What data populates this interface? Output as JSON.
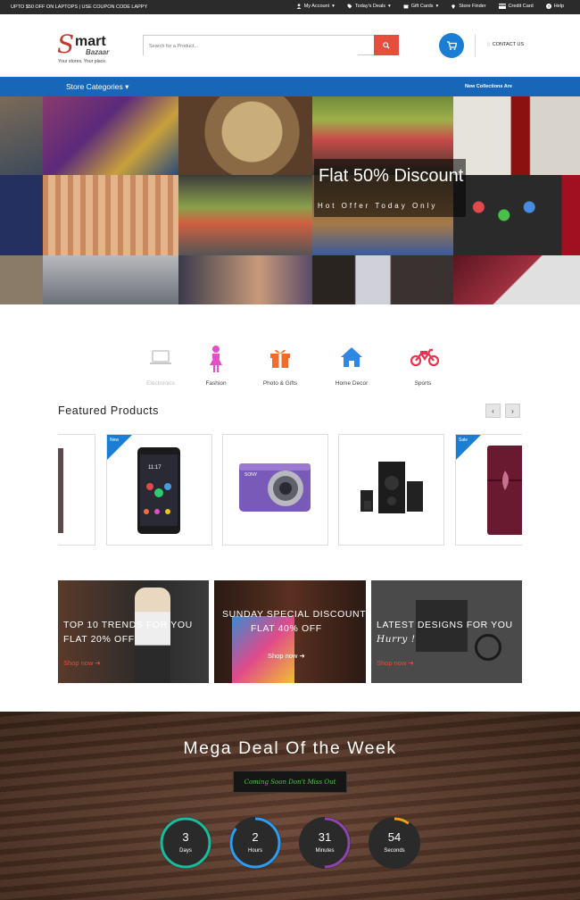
{
  "topbar": {
    "promo": "UPTO $50 OFF ON LAPTOPS | USE COUPON CODE LAPPY",
    "links": [
      {
        "label": "My Account",
        "icon": "user-icon"
      },
      {
        "label": "Today's Deals",
        "icon": "tag-icon"
      },
      {
        "label": "Gift Cards",
        "icon": "gift-icon"
      },
      {
        "label": "Store Finder",
        "icon": "map-pin-icon"
      },
      {
        "label": "Credit Card",
        "icon": "credit-card-icon"
      },
      {
        "label": "Help",
        "icon": "help-icon"
      }
    ]
  },
  "header": {
    "logo_letter": "S",
    "logo_word": "mart",
    "logo_sub": "Bazaar",
    "tagline": "Your stores. Your place.",
    "search_placeholder": "Search for a Product...",
    "contact": "CONTACT US"
  },
  "catbar": {
    "label": "Store Categories",
    "marquee": "New Collections Are"
  },
  "hero": {
    "title": "Flat 50% Discount",
    "subtitle": "Hot Offer Today Only"
  },
  "categories": [
    {
      "label": "Electronics",
      "icon": "laptop-icon",
      "color": "#c8c8c8"
    },
    {
      "label": "Fashion",
      "icon": "woman-icon",
      "color": "#e64ec7"
    },
    {
      "label": "Photo & Gifts",
      "icon": "gift-icon",
      "color": "#f26b2a"
    },
    {
      "label": "Home Decor",
      "icon": "house-icon",
      "color": "#2e86e6"
    },
    {
      "label": "Sports",
      "icon": "motorbike-icon",
      "color": "#e8344e"
    }
  ],
  "featured": {
    "title": "Featured Products",
    "prev": "‹",
    "next": "›",
    "badges": {
      "new": "New",
      "sale": "Sale"
    }
  },
  "banners": [
    {
      "line1": "TOP 10 TRENDS FOR YOU",
      "line2": "FLAT 20% OFF",
      "shop": "Shop now"
    },
    {
      "line1": "SUNDAY SPECIAL DISCOUNT",
      "line2": "FLAT 40% OFF",
      "shop": "Shop now"
    },
    {
      "line1": "LATEST DESIGNS FOR YOU",
      "line2": "Hurry !",
      "shop": "Shop now"
    }
  ],
  "deal": {
    "title": "Mega Deal Of the Week",
    "subtitle": "Coming Soon Don't Miss Out",
    "timers": [
      {
        "value": "3",
        "unit": "Days",
        "color": "#1abc9c",
        "fraction": 1.0
      },
      {
        "value": "2",
        "unit": "Hours",
        "color": "#2e9cf0",
        "fraction": 0.85
      },
      {
        "value": "31",
        "unit": "Minutes",
        "color": "#8e44ad",
        "fraction": 0.5
      },
      {
        "value": "54",
        "unit": "Seconds",
        "color": "#f39c12",
        "fraction": 0.1
      }
    ]
  },
  "colors": {
    "accent": "#1766b8",
    "search_btn": "#e74c3c",
    "cart": "#1a7fd4"
  }
}
